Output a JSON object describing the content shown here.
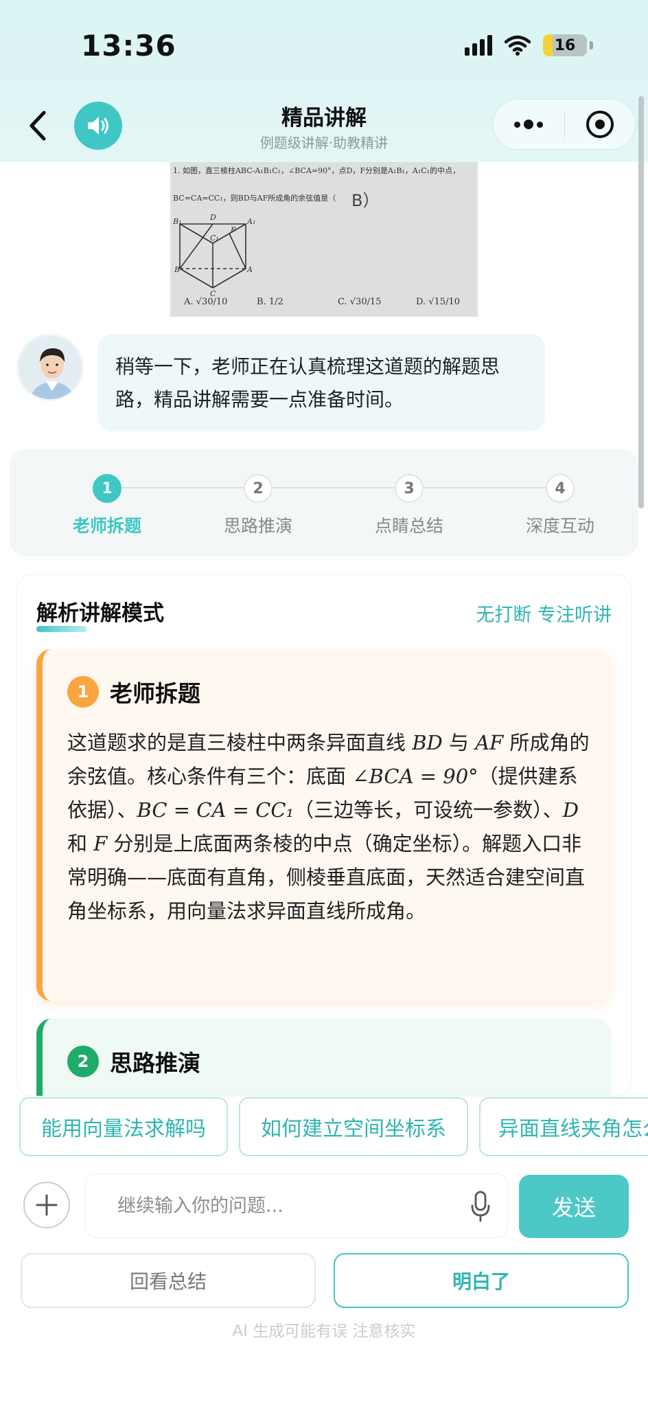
{
  "status_bar": {
    "time": "13:36",
    "battery": "16"
  },
  "nav": {
    "title": "精品讲解",
    "subtitle": "例题级讲解·助教精讲"
  },
  "problem_image": {
    "line1": "1. 如图，直三棱柱ABC-A₁B₁C₁，∠BCA=90°，点D，F分别是A₁B₁，A₁C₁的中点，",
    "line2": "BC=CA=CC₁，则BD与AF所成角的余弦值是（",
    "handwritten": "B）",
    "labels": {
      "B1": "B₁",
      "D": "D",
      "A1": "A₁",
      "C1": "C₁",
      "F": "F",
      "B": "B",
      "A": "A",
      "C": "C"
    },
    "options": [
      {
        "letter": "A.",
        "num": "√30",
        "den": "10"
      },
      {
        "letter": "B.",
        "num": "1",
        "den": "2"
      },
      {
        "letter": "C.",
        "num": "√30",
        "den": "15"
      },
      {
        "letter": "D.",
        "num": "√15",
        "den": "10"
      }
    ]
  },
  "message": {
    "text": "稍等一下，老师正在认真梳理这道题的解题思路，精品讲解需要一点准备时间。"
  },
  "steps": [
    {
      "num": "1",
      "label": "老师拆题"
    },
    {
      "num": "2",
      "label": "思路推演"
    },
    {
      "num": "3",
      "label": "点睛总结"
    },
    {
      "num": "4",
      "label": "深度互动"
    }
  ],
  "mode": {
    "title": "解析讲解模式",
    "right": "无打断 专注听讲"
  },
  "section1": {
    "num": "1",
    "title": "老师拆题",
    "t1": "这道题求的是直三棱柱中两条异面直线 ",
    "m1": "BD",
    "t2": " 与 ",
    "m2": "AF",
    "t3": " 所成角的余弦值。核心条件有三个：底面 ",
    "m3": "∠BCA = 90°",
    "t4": "（提供建系依据）、",
    "m4": "BC = CA = CC₁",
    "t5": "（三边等长，可设统一参数）、",
    "m5": "D",
    "t6": " 和 ",
    "m6": "F",
    "t7": " 分别是上底面两条棱的中点（确定坐标）。解题入口非常明确——底面有直角，侧棱垂直底面，天然适合建空间直角坐标系，用向量法求异面直线所成角。"
  },
  "section2": {
    "num": "2",
    "title": "思路推演"
  },
  "chips": [
    "能用向量法求解吗",
    "如何建立空间坐标系",
    "异面直线夹角怎么求"
  ],
  "input": {
    "placeholder": "继续输入你的问题..."
  },
  "buttons": {
    "send": "发送",
    "review": "回看总结",
    "understood": "明白了"
  },
  "disclaimer": "AI 生成可能有误 注意核实",
  "colors": {
    "accent": "#3ec7c4",
    "orange": "#fba540",
    "green": "#1fab6a"
  }
}
